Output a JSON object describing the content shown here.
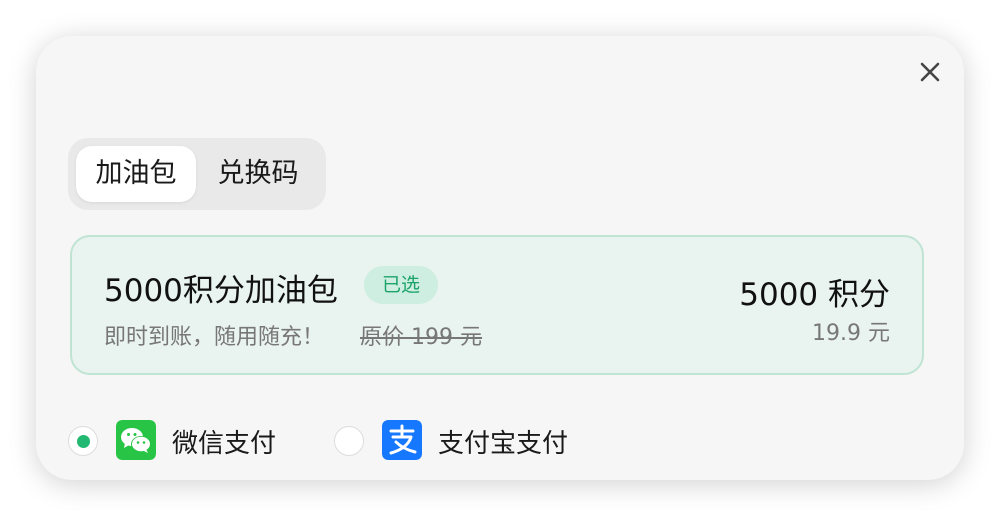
{
  "dialog": {
    "close_icon": "close-icon"
  },
  "tabs": [
    {
      "label": "加油包",
      "active": true
    },
    {
      "label": "兑换码",
      "active": false
    }
  ],
  "package": {
    "name": "5000积分加油包",
    "badge": "已选",
    "description": "即时到账，随用随充！",
    "original_price": "原价 199 元",
    "points": "5000 积分",
    "price": "19.9 元",
    "selected": true
  },
  "payment_methods": [
    {
      "label": "微信支付",
      "icon": "wechat-icon",
      "selected": true
    },
    {
      "label": "支付宝支付",
      "icon": "alipay-icon",
      "selected": false
    }
  ],
  "colors": {
    "accent_green": "#21b872",
    "badge_text": "#1ba36a",
    "card_bg": "#e9f3ef",
    "card_border": "#bfe4d3",
    "wechat_green": "#28c445",
    "alipay_blue": "#1677ff"
  }
}
